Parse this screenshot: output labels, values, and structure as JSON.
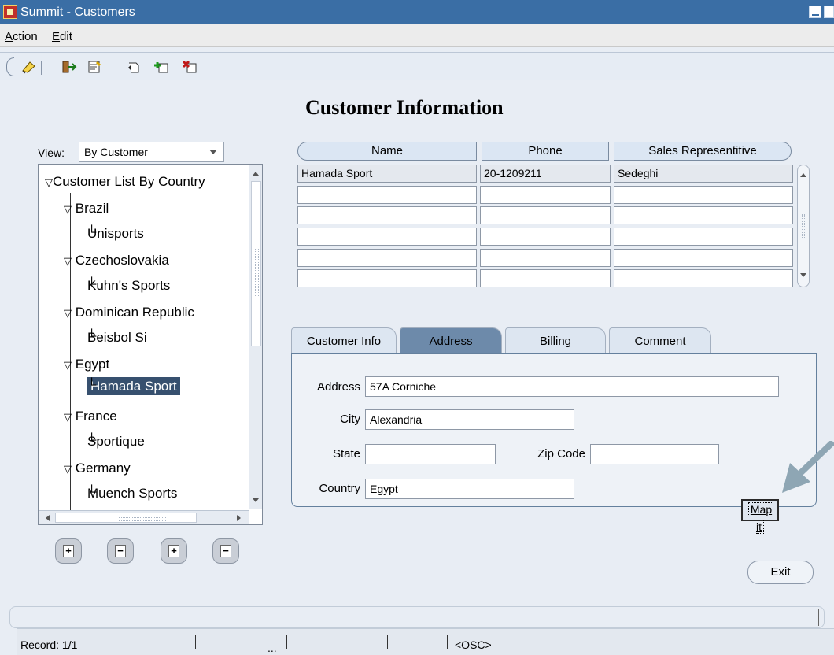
{
  "window": {
    "title": "Summit - Customers"
  },
  "menu": [
    {
      "label": "Action",
      "mnemonic": "A",
      "rest": "ction"
    },
    {
      "label": "Edit",
      "mnemonic": "E",
      "rest": "dit"
    }
  ],
  "toolbar": {
    "icons": [
      "enter-query-icon",
      "exit-icon",
      "save-icon",
      "undo-icon",
      "insert-record-icon",
      "delete-record-icon"
    ]
  },
  "heading": "Customer Information",
  "view": {
    "label": "View:",
    "selected": "By Customer"
  },
  "tree": {
    "root": "Customer List By Country",
    "countries": [
      {
        "name": "Brazil",
        "customers": [
          "Unisports"
        ]
      },
      {
        "name": "Czechoslovakia",
        "customers": [
          "Kuhn's Sports"
        ]
      },
      {
        "name": "Dominican Republic",
        "customers": [
          "Beisbol Si"
        ]
      },
      {
        "name": "Egypt",
        "customers": [
          "Hamada Sport"
        ]
      },
      {
        "name": "France",
        "customers": [
          "Sportique"
        ]
      },
      {
        "name": "Germany",
        "customers": [
          "Muench Sports"
        ]
      }
    ],
    "selected": "Hamada Sport",
    "buttons": [
      "expand-button",
      "collapse-button",
      "expand-all-button",
      "collapse-all-button"
    ]
  },
  "grid": {
    "columns": [
      "Name",
      "Phone",
      "Sales Representitive"
    ],
    "rows": [
      [
        "Hamada Sport",
        "20-1209211",
        "Sedeghi"
      ],
      [
        "",
        "",
        ""
      ],
      [
        "",
        "",
        ""
      ],
      [
        "",
        "",
        ""
      ],
      [
        "",
        "",
        ""
      ],
      [
        "",
        "",
        ""
      ]
    ]
  },
  "tabs": [
    {
      "label": "Customer Info",
      "active": false
    },
    {
      "label": "Address",
      "active": true
    },
    {
      "label": "Billing",
      "active": false
    },
    {
      "label": "Comment",
      "active": false
    }
  ],
  "address": {
    "address_label": "Address",
    "address_value": "57A Corniche",
    "city_label": "City",
    "city_value": "Alexandria",
    "state_label": "State",
    "state_value": "",
    "zip_label": "Zip Code",
    "zip_value": "",
    "country_label": "Country",
    "country_value": "Egypt",
    "map_button": "Map it"
  },
  "exit_button": "Exit",
  "status": {
    "record": "Record: 1/1",
    "ellipsis": "...",
    "osc": "<OSC>"
  },
  "colors": {
    "titlebar": "#3a6ea5",
    "selected_node": "#37506f",
    "active_tab": "#6d8aaa",
    "annotation_arrow": "#8ea6b4"
  }
}
